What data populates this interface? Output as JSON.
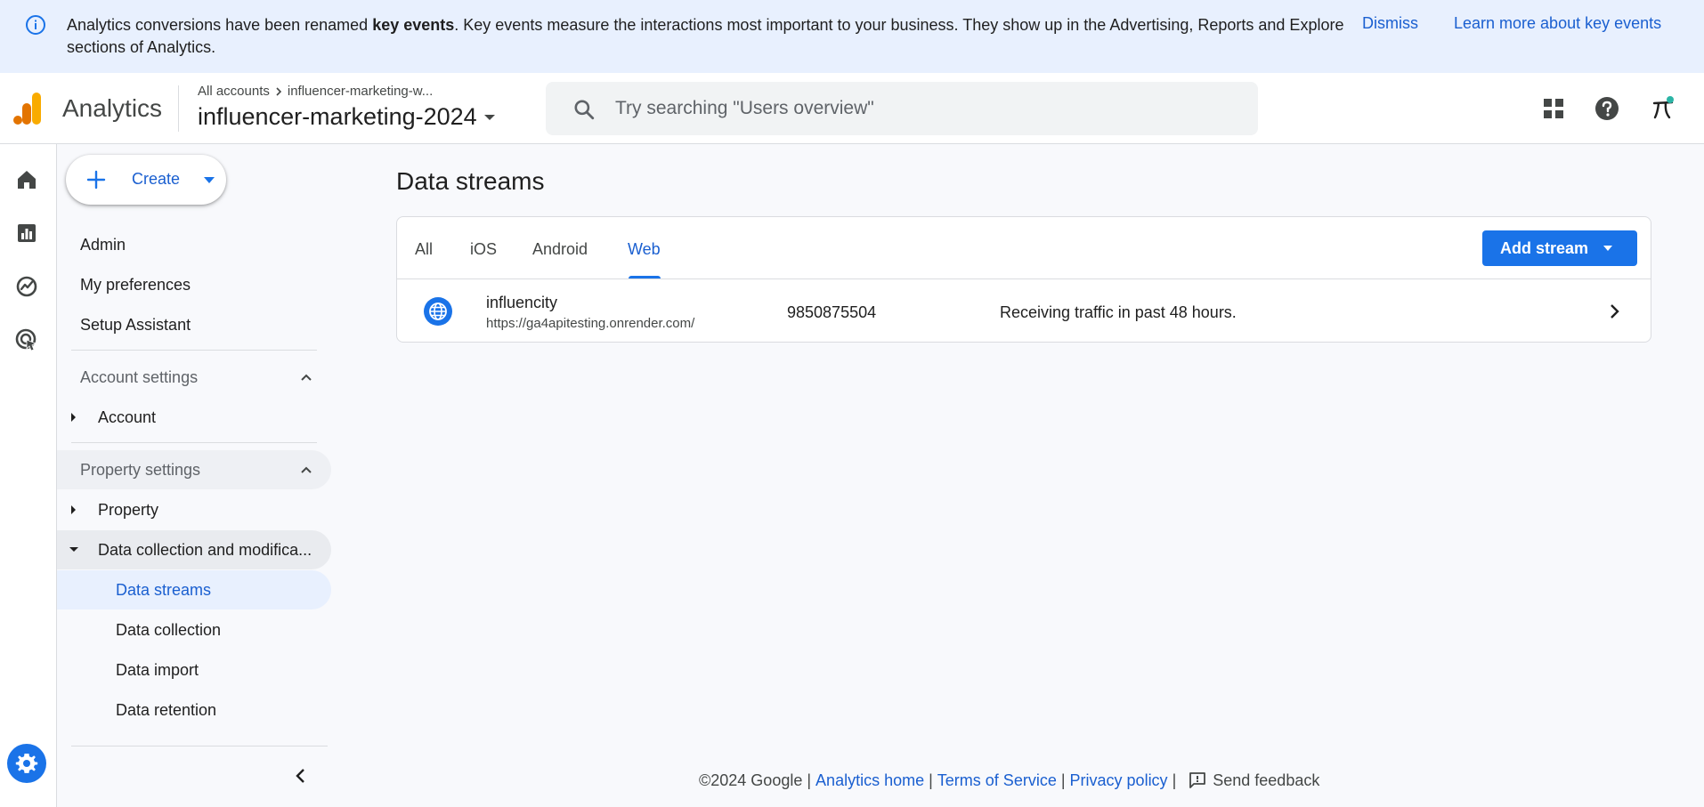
{
  "banner": {
    "message_prefix": "Analytics conversions have been renamed ",
    "message_bold": "key events",
    "message_suffix": ". Key events measure the interactions most important to your business. They show up in the Advertising, Reports and Explore sections of Analytics.",
    "dismiss_label": "Dismiss",
    "learn_more_label": "Learn more about key events"
  },
  "header": {
    "app_name": "Analytics",
    "breadcrumb_root": "All accounts",
    "breadcrumb_account": "influencer-marketing-w...",
    "property_name": "influencer-marketing-2024",
    "search_placeholder": "Try searching \"Users overview\""
  },
  "sidenav": {
    "create_label": "Create",
    "admin_label": "Admin",
    "preferences_label": "My preferences",
    "setup_label": "Setup Assistant",
    "account_settings_label": "Account settings",
    "account_label": "Account",
    "property_settings_label": "Property settings",
    "property_label": "Property",
    "data_collection_mod_label": "Data collection and modifica...",
    "sub_items": [
      "Data streams",
      "Data collection",
      "Data import",
      "Data retention"
    ]
  },
  "main": {
    "title": "Data streams",
    "tabs": [
      "All",
      "iOS",
      "Android",
      "Web"
    ],
    "active_tab": "Web",
    "add_stream_label": "Add stream",
    "stream": {
      "name": "influencity",
      "url": "https://ga4apitesting.onrender.com/",
      "id": "9850875504",
      "status": "Receiving traffic in past 48 hours."
    }
  },
  "footer": {
    "copyright": "©2024 Google",
    "analytics_home": "Analytics home",
    "terms": "Terms of Service",
    "privacy": "Privacy policy",
    "feedback": "Send feedback"
  },
  "colors": {
    "accent": "#1a73e8",
    "link": "#1a5fd0",
    "banner_bg": "#e8f0fe",
    "logo_orange": "#f9ab00",
    "logo_dark_orange": "#e37400"
  }
}
